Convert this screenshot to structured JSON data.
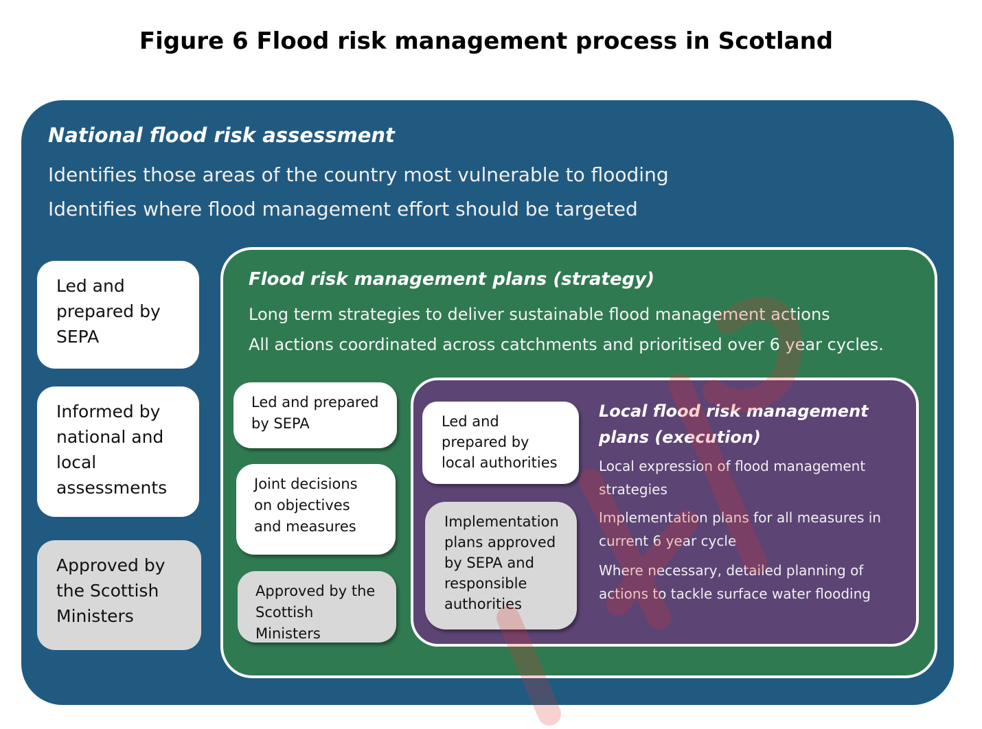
{
  "title": "Figure 6  Flood risk management process in Scotland",
  "national": {
    "title": "National flood risk assessment",
    "lines": [
      "Identifies those areas of the country most vulnerable to flooding",
      "Identifies where flood management effort should be targeted"
    ],
    "cards": [
      "Led and prepared by SEPA",
      "Informed by national and local assessments",
      "Approved by the Scottish Ministers"
    ]
  },
  "strategy": {
    "title": "Flood risk management plans (strategy)",
    "lines": [
      "Long term strategies to deliver sustainable flood management actions",
      "All actions coordinated across catchments and prioritised over 6 year cycles."
    ],
    "cards": [
      "Led and prepared by SEPA",
      "Joint decisions on objectives and measures",
      "Approved by the Scottish Ministers"
    ]
  },
  "local": {
    "title": "Local flood risk management plans (execution)",
    "points": [
      "Local expression of flood management strategies",
      "Implementation plans for all measures in current 6 year cycle",
      "Where necessary, detailed planning of actions to tackle surface water flooding"
    ],
    "cards": [
      "Led and prepared by local authorities",
      "Implementation plans approved by SEPA and responsible authorities"
    ]
  },
  "colors": {
    "national": "#215a80",
    "strategy": "#307a52",
    "local": "#5c4475",
    "approval_card": "#d8d8d8",
    "watermark": "#e0312b"
  }
}
